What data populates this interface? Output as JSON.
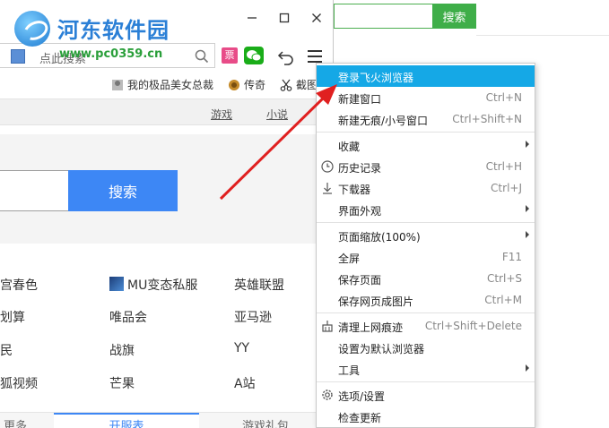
{
  "background": {
    "search_button": "搜索"
  },
  "window": {
    "logo_text": "河东软件园",
    "logo_url": "www.pc0359.cn",
    "address_placeholder": "点此搜索",
    "toolbar_piao": "票"
  },
  "bookmarks": [
    {
      "label": "我的极品美女总裁"
    },
    {
      "label": "传奇"
    },
    {
      "label": "截图"
    }
  ],
  "page": {
    "nav": {
      "games": "游戏",
      "novels": "小说"
    },
    "search_button": "搜索",
    "links": [
      {
        "label": "宫春色"
      },
      {
        "label": "MU变态私服"
      },
      {
        "label": "英雄联盟"
      },
      {
        "label": "划算"
      },
      {
        "label": "唯品会"
      },
      {
        "label": "亚马逊"
      },
      {
        "label": "民"
      },
      {
        "label": "战旗"
      },
      {
        "label": "YY"
      },
      {
        "label": "狐视频"
      },
      {
        "label": "芒果"
      },
      {
        "label": "A站"
      }
    ],
    "bottom_tabs": {
      "left": "更多",
      "active": "开服表",
      "right": "游戏礼包"
    }
  },
  "menu": {
    "items": [
      {
        "label": "登录飞火浏览器",
        "shortcut": ""
      },
      {
        "label": "新建窗口",
        "shortcut": "Ctrl+N"
      },
      {
        "label": "新建无痕/小号窗口",
        "shortcut": "Ctrl+Shift+N"
      },
      {
        "label": "收藏",
        "shortcut": ""
      },
      {
        "label": "历史记录",
        "shortcut": "Ctrl+H"
      },
      {
        "label": "下载器",
        "shortcut": "Ctrl+J"
      },
      {
        "label": "界面外观",
        "shortcut": ""
      },
      {
        "label": "页面缩放(100%)",
        "shortcut": ""
      },
      {
        "label": "全屏",
        "shortcut": "F11"
      },
      {
        "label": "保存页面",
        "shortcut": "Ctrl+S"
      },
      {
        "label": "保存网页成图片",
        "shortcut": "Ctrl+M"
      },
      {
        "label": "清理上网痕迹",
        "shortcut": "Ctrl+Shift+Delete"
      },
      {
        "label": "设置为默认浏览器",
        "shortcut": ""
      },
      {
        "label": "工具",
        "shortcut": ""
      },
      {
        "label": "选项/设置",
        "shortcut": ""
      },
      {
        "label": "检查更新",
        "shortcut": ""
      }
    ]
  },
  "colors": {
    "menu_highlight": "#15a8e6",
    "search_blue": "#3d87f5",
    "bg_search_green": "#3fae49",
    "annotation_red": "#e02020"
  }
}
